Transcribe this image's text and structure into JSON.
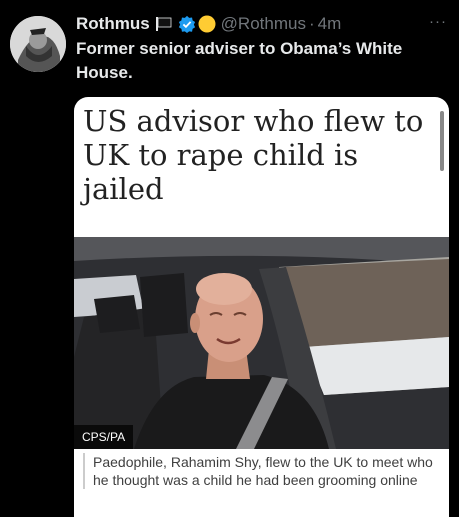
{
  "tweet": {
    "display_name": "Rothmus",
    "handle": "@Rothmus",
    "separator": "·",
    "time": "4m",
    "more_label": "···",
    "text": "Former senior adviser to Obama’s White House."
  },
  "card": {
    "headline": "US advisor who flew to UK to rape child is jailed",
    "photo_credit": "CPS/PA",
    "caption": "Paedophile, Rahamim Shy, flew to the UK to meet who he thought was a child he had been grooming online"
  },
  "colors": {
    "background": "#000000",
    "text_primary": "#e7e9ea",
    "text_secondary": "#71767b",
    "verified_blue": "#1d9bf0",
    "emoji_yellow": "#ffcc33"
  },
  "icons": {
    "flag": "black-flag-icon",
    "verified": "verified-badge-icon",
    "emoji": "smiley-emoji-icon",
    "more": "more-icon"
  }
}
